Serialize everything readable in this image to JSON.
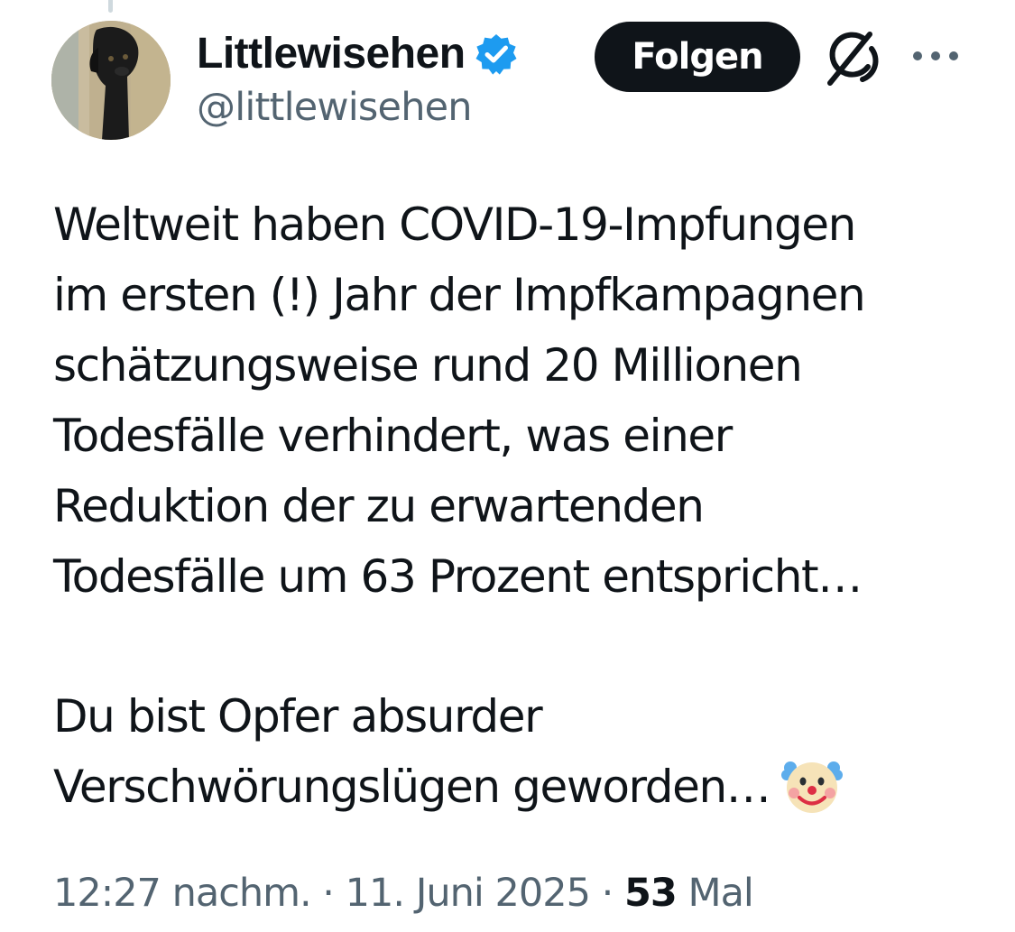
{
  "author": {
    "display_name": "Littlewisehen",
    "handle": "@littlewisehen",
    "verified": true,
    "verified_color": "#1d9bf0"
  },
  "actions": {
    "follow_label": "Folgen",
    "grok_icon": "grok-icon",
    "more_icon": "more-icon"
  },
  "tweet": {
    "lines": [
      "Weltweit haben COVID-19-Impfungen",
      "im ersten (!) Jahr der Impfkampagnen",
      "schätzungsweise rund 20 Millionen",
      "Todesfälle verhindert, was einer",
      "Reduktion der zu erwartenden",
      "Todesfälle um 63 Prozent entspricht…"
    ],
    "lines2": [
      "Du bist Opfer absurder",
      "Verschwörungslügen geworden…"
    ],
    "emoji": "clown-face-icon"
  },
  "meta": {
    "time": "12:27 nachm.",
    "separator": " · ",
    "date": "11. Juni 2025",
    "views_count": "53",
    "views_label": "Mal"
  },
  "colors": {
    "text_primary": "#0f1419",
    "text_secondary": "#536471",
    "button_bg": "#0f1419"
  }
}
